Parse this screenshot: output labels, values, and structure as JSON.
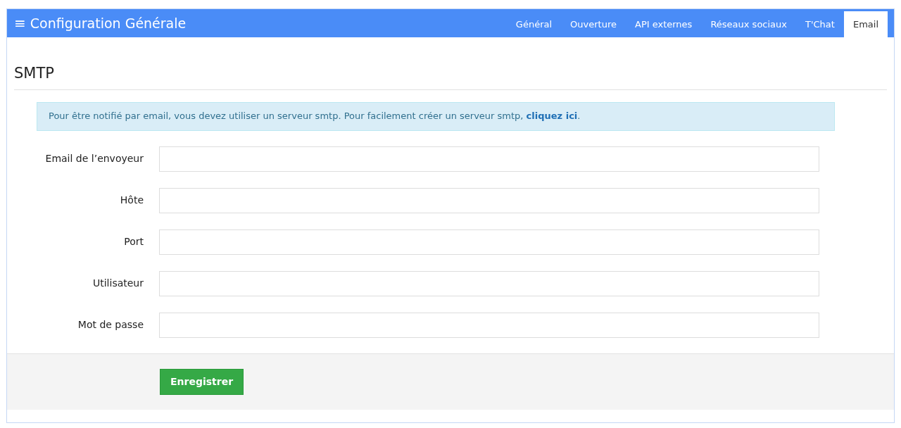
{
  "header": {
    "menu_glyph": "≡",
    "title": "Configuration Générale"
  },
  "tabs": [
    {
      "label": "Général",
      "selected": false
    },
    {
      "label": "Ouverture",
      "selected": false
    },
    {
      "label": "API externes",
      "selected": false
    },
    {
      "label": "Réseaux sociaux",
      "selected": false
    },
    {
      "label": "T'Chat",
      "selected": false
    },
    {
      "label": "Email",
      "selected": true
    }
  ],
  "section_title": "SMTP",
  "alert": {
    "text": "Pour être notifié par email, vous devez utiliser un serveur smtp. Pour facilement créer un serveur smtp, ",
    "link": "cliquez ici",
    "text_after": "."
  },
  "fields": [
    {
      "label": "Email de l’envoyeur"
    },
    {
      "label": "Hôte"
    },
    {
      "label": "Port"
    },
    {
      "label": "Utilisateur"
    },
    {
      "label": "Mot de passe"
    }
  ],
  "save_button": "Enregistrer"
}
